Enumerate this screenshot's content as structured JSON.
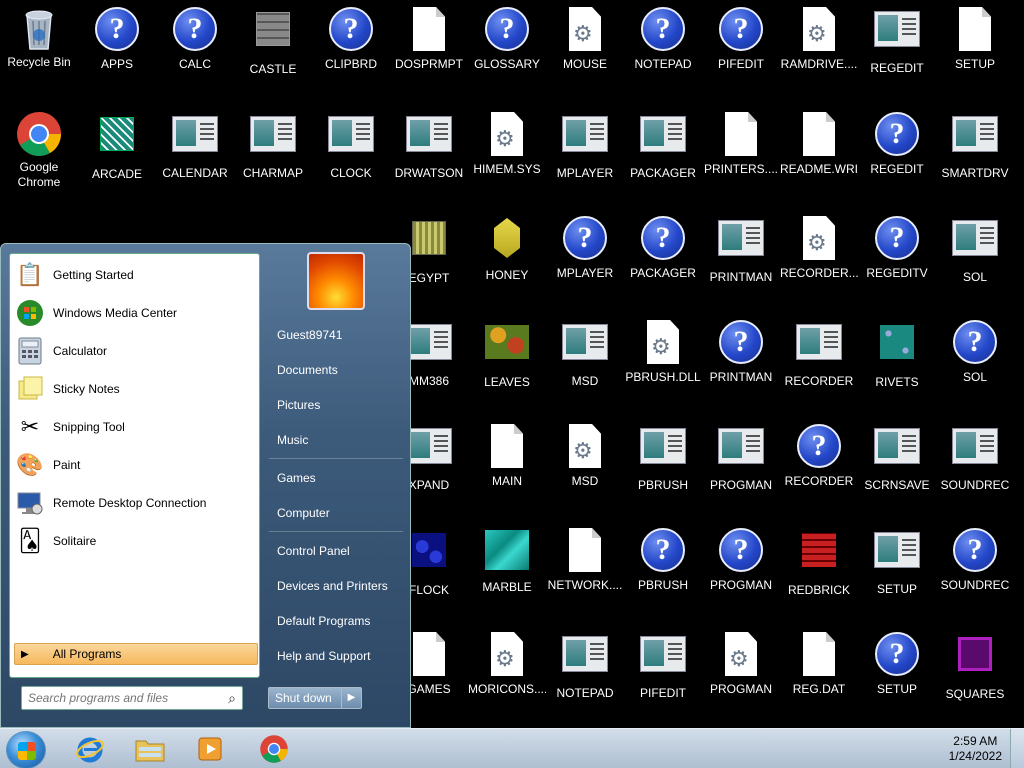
{
  "desktop": {
    "icons": [
      {
        "label": "Recycle Bin",
        "icon": "recycle-bin-icon"
      },
      {
        "label": "APPS",
        "icon": "help-icon"
      },
      {
        "label": "CALC",
        "icon": "help-icon"
      },
      {
        "label": "CASTLE",
        "icon": "castle-tile-icon"
      },
      {
        "label": "CLIPBRD",
        "icon": "help-icon"
      },
      {
        "label": "DOSPRMPT",
        "icon": "shortcut-document-icon"
      },
      {
        "label": "GLOSSARY",
        "icon": "help-icon"
      },
      {
        "label": "MOUSE",
        "icon": "settings-document-icon"
      },
      {
        "label": "NOTEPAD",
        "icon": "help-icon"
      },
      {
        "label": "PIFEDIT",
        "icon": "help-icon"
      },
      {
        "label": "RAMDRIVE....",
        "icon": "settings-document-icon"
      },
      {
        "label": "REGEDIT",
        "icon": "window-icon"
      },
      {
        "label": "SETUP",
        "icon": "document-icon"
      },
      {
        "label": "Google Chrome",
        "icon": "chrome-icon"
      },
      {
        "label": "ARCADE",
        "icon": "arcade-tile-icon"
      },
      {
        "label": "CALENDAR",
        "icon": "window-icon"
      },
      {
        "label": "CHARMAP",
        "icon": "window-icon"
      },
      {
        "label": "CLOCK",
        "icon": "window-icon"
      },
      {
        "label": "DRWATSON",
        "icon": "window-icon"
      },
      {
        "label": "HIMEM.SYS",
        "icon": "settings-document-icon"
      },
      {
        "label": "MPLAYER",
        "icon": "window-icon"
      },
      {
        "label": "PACKAGER",
        "icon": "window-icon"
      },
      {
        "label": "PRINTERS....",
        "icon": "document-icon"
      },
      {
        "label": "README.WRI",
        "icon": "document-icon"
      },
      {
        "label": "REGEDIT",
        "icon": "help-icon"
      },
      {
        "label": "SMARTDRV",
        "icon": "window-icon"
      },
      {
        "label": "EGYPT",
        "icon": "egypt-tile-icon"
      },
      {
        "label": "HONEY",
        "icon": "honey-tile-icon"
      },
      {
        "label": "MPLAYER",
        "icon": "help-icon"
      },
      {
        "label": "PACKAGER",
        "icon": "help-icon"
      },
      {
        "label": "PRINTMAN",
        "icon": "window-icon"
      },
      {
        "label": "RECORDER....",
        "icon": "settings-document-icon"
      },
      {
        "label": "REGEDITV",
        "icon": "help-icon"
      },
      {
        "label": "SOL",
        "icon": "window-icon"
      },
      {
        "label": "MM386",
        "icon": "window-icon"
      },
      {
        "label": "LEAVES",
        "icon": "leaves-tile-icon"
      },
      {
        "label": "MSD",
        "icon": "window-icon"
      },
      {
        "label": "PBRUSH.DLL",
        "icon": "settings-document-icon"
      },
      {
        "label": "PRINTMAN",
        "icon": "help-icon"
      },
      {
        "label": "RECORDER",
        "icon": "window-icon"
      },
      {
        "label": "RIVETS",
        "icon": "rivets-tile-icon"
      },
      {
        "label": "SOL",
        "icon": "help-icon"
      },
      {
        "label": "XPAND",
        "icon": "window-icon"
      },
      {
        "label": "MAIN",
        "icon": "document-icon"
      },
      {
        "label": "MSD",
        "icon": "settings-document-icon"
      },
      {
        "label": "PBRUSH",
        "icon": "window-icon"
      },
      {
        "label": "PROGMAN",
        "icon": "window-icon"
      },
      {
        "label": "RECORDER",
        "icon": "help-icon"
      },
      {
        "label": "SCRNSAVE",
        "icon": "window-icon"
      },
      {
        "label": "SOUNDREC",
        "icon": "window-icon"
      },
      {
        "label": "FLOCK",
        "icon": "flock-tile-icon"
      },
      {
        "label": "MARBLE",
        "icon": "marble-tile-icon"
      },
      {
        "label": "NETWORK....",
        "icon": "document-icon"
      },
      {
        "label": "PBRUSH",
        "icon": "help-icon"
      },
      {
        "label": "PROGMAN",
        "icon": "help-icon"
      },
      {
        "label": "REDBRICK",
        "icon": "redbrick-tile-icon"
      },
      {
        "label": "SETUP",
        "icon": "setup-shield-icon"
      },
      {
        "label": "SOUNDREC",
        "icon": "help-icon"
      },
      {
        "label": "GAMES",
        "icon": "document-icon"
      },
      {
        "label": "MORICONS....",
        "icon": "settings-document-icon"
      },
      {
        "label": "NOTEPAD",
        "icon": "window-icon"
      },
      {
        "label": "PIFEDIT",
        "icon": "window-icon"
      },
      {
        "label": "PROGMAN",
        "icon": "settings-document-icon"
      },
      {
        "label": "REG.DAT",
        "icon": "document-icon"
      },
      {
        "label": "SETUP",
        "icon": "help-icon"
      },
      {
        "label": "SQUARES",
        "icon": "squares-tile-icon"
      }
    ]
  },
  "start_menu": {
    "programs": [
      {
        "label": "Getting Started",
        "icon": "getting-started-icon"
      },
      {
        "label": "Windows Media Center",
        "icon": "media-center-icon"
      },
      {
        "label": "Calculator",
        "icon": "calculator-icon"
      },
      {
        "label": "Sticky Notes",
        "icon": "sticky-notes-icon"
      },
      {
        "label": "Snipping Tool",
        "icon": "snipping-tool-icon"
      },
      {
        "label": "Paint",
        "icon": "paint-icon"
      },
      {
        "label": "Remote Desktop Connection",
        "icon": "remote-desktop-icon"
      },
      {
        "label": "Solitaire",
        "icon": "solitaire-icon"
      }
    ],
    "all_programs": "All Programs",
    "search_placeholder": "Search programs and files",
    "right": {
      "user": "Guest89741",
      "documents": "Documents",
      "pictures": "Pictures",
      "music": "Music",
      "games": "Games",
      "computer": "Computer",
      "control_panel": "Control Panel",
      "devices": "Devices and Printers",
      "default_programs": "Default Programs",
      "help": "Help and Support"
    },
    "shutdown": "Shut down"
  },
  "taskbar": {
    "time": "2:59 AM",
    "date": "1/24/2022"
  }
}
